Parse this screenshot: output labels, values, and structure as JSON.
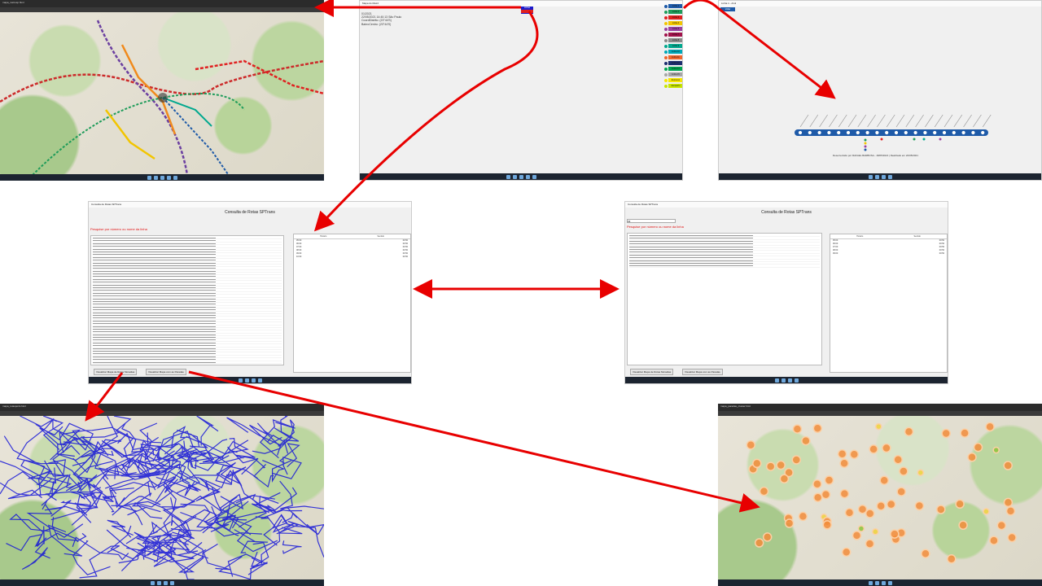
{
  "panels": {
    "metro_map_window": {
      "title": "mapa_metrosp.html"
    },
    "info_window": {
      "title": "Mapa do Metrô",
      "button_label": "Linhas",
      "info_lines": [
        "01/2021",
        "22/05/2021 14:40:13 São Paulo",
        "CoordDistrito: (23°44'S)",
        "BairroCentro: (23°44'S)"
      ],
      "legend": [
        {
          "label": "Linha 1",
          "color": "#1e5aa8"
        },
        {
          "label": "Linha 2",
          "color": "#1e9c5a"
        },
        {
          "label": "Linha 3",
          "color": "#e02020"
        },
        {
          "label": "Linha 4",
          "color": "#f2c500"
        },
        {
          "label": "Linha 5",
          "color": "#9a3fa0"
        },
        {
          "label": "Linha 7",
          "color": "#a0134b"
        },
        {
          "label": "Linha 8",
          "color": "#8a8a8a"
        },
        {
          "label": "Linha 9",
          "color": "#00a88e"
        },
        {
          "label": "Linha 10",
          "color": "#00a8b8"
        },
        {
          "label": "Linha 11",
          "color": "#f0642c"
        },
        {
          "label": "Linha 12",
          "color": "#1d2f6f"
        },
        {
          "label": "Linha 13",
          "color": "#00a651"
        },
        {
          "label": "Linha 15",
          "color": "#a6a6a6"
        },
        {
          "label": "Expresso",
          "color": "#f7e600"
        },
        {
          "label": "Aeroporto",
          "color": "#c8e600"
        }
      ]
    },
    "line_diagram_window": {
      "title": "Linha 1 - Azul",
      "button_label": "Voltar",
      "footer": "Desenvolvido por RAFAEL BARBOSA - 18/05/2021 | Realizado em 22/05/2021"
    },
    "route_search_left": {
      "window_title": "Consulta de Rotas SPTrans",
      "header": "Consulta de Rotas SPTrans",
      "prompt": "Pesquise por número ou nome da linha",
      "search_value": "",
      "grid_headers": [
        "Horário",
        "Sentido"
      ],
      "grid_rows": [
        [
          "05:00",
          "00:50"
        ],
        [
          "06:00",
          "00:50"
        ],
        [
          "07:00",
          "00:50"
        ],
        [
          "08:00",
          "00:50"
        ],
        [
          "09:00",
          "00:50"
        ],
        [
          "10:00",
          "00:50"
        ]
      ],
      "btn_map_routes": "Visualizar Mapa de Rotas Moradias",
      "btn_map_stops": "Visualizar Mapa com as Paradas"
    },
    "route_search_right": {
      "window_title": "Consulta de Rotas SPTrans",
      "header": "Consulta de Rotas SPTrans",
      "prompt": "Pesquise por número ou nome da linha",
      "search_value": "23",
      "grid_headers": [
        "Horário",
        "Sentido"
      ],
      "grid_rows": [
        [
          "05:00",
          "00:50"
        ],
        [
          "06:00",
          "00:50"
        ],
        [
          "07:00",
          "00:50"
        ],
        [
          "08:00",
          "00:50"
        ],
        [
          "09:00",
          "00:50"
        ]
      ],
      "btn_map_routes": "Visualizar Mapa de Rotas Moradias",
      "btn_map_stops": "Visualizar Mapa com as Paradas"
    },
    "routes_map_window": {
      "title": "mapa_rotaspoint.html"
    },
    "stops_map_window": {
      "title": "mapa_paradas_cluster.html"
    }
  }
}
